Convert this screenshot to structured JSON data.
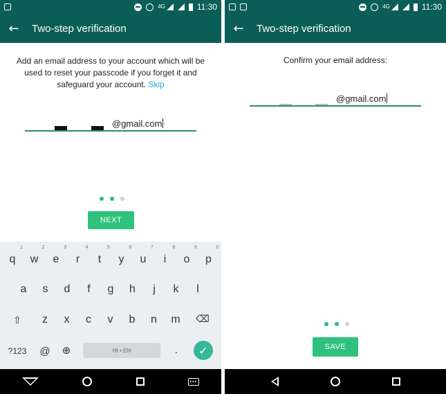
{
  "status_bar": {
    "network": "4G",
    "time": "11:30"
  },
  "left_screen": {
    "app_bar": {
      "title": "Two-step verification"
    },
    "message": {
      "text": "Add an email address to your account which will be used to reset your passcode if you forget it and safeguard your account.",
      "skip_link": "Skip"
    },
    "email_field": {
      "domain": "@gmail.com"
    },
    "page_dots": {
      "active": 2,
      "total": 3
    },
    "next_button": "NEXT",
    "keyboard": {
      "row1": [
        {
          "key": "q",
          "hint": "1"
        },
        {
          "key": "w",
          "hint": "2"
        },
        {
          "key": "e",
          "hint": "3"
        },
        {
          "key": "r",
          "hint": "4"
        },
        {
          "key": "t",
          "hint": "5"
        },
        {
          "key": "y",
          "hint": "6"
        },
        {
          "key": "u",
          "hint": "7"
        },
        {
          "key": "i",
          "hint": "8"
        },
        {
          "key": "o",
          "hint": "9"
        },
        {
          "key": "p",
          "hint": "0"
        }
      ],
      "row2": [
        "a",
        "s",
        "d",
        "f",
        "g",
        "h",
        "j",
        "k",
        "l"
      ],
      "row3": [
        "z",
        "x",
        "c",
        "v",
        "b",
        "n",
        "m"
      ],
      "symbols_key": "?123",
      "at_key": "@",
      "space_label": "HI • EN",
      "period_key": "."
    }
  },
  "right_screen": {
    "app_bar": {
      "title": "Two-step verification"
    },
    "message": "Confirm your email address:",
    "email_field": {
      "domain": "@gmail.com"
    },
    "page_dots": {
      "active": 2,
      "total": 3
    },
    "save_button": "SAVE"
  },
  "colors": {
    "app_bar": "#0b5e55",
    "accent": "#2ec27e",
    "dot_active": "#2bb596",
    "link": "#27a6d8"
  }
}
